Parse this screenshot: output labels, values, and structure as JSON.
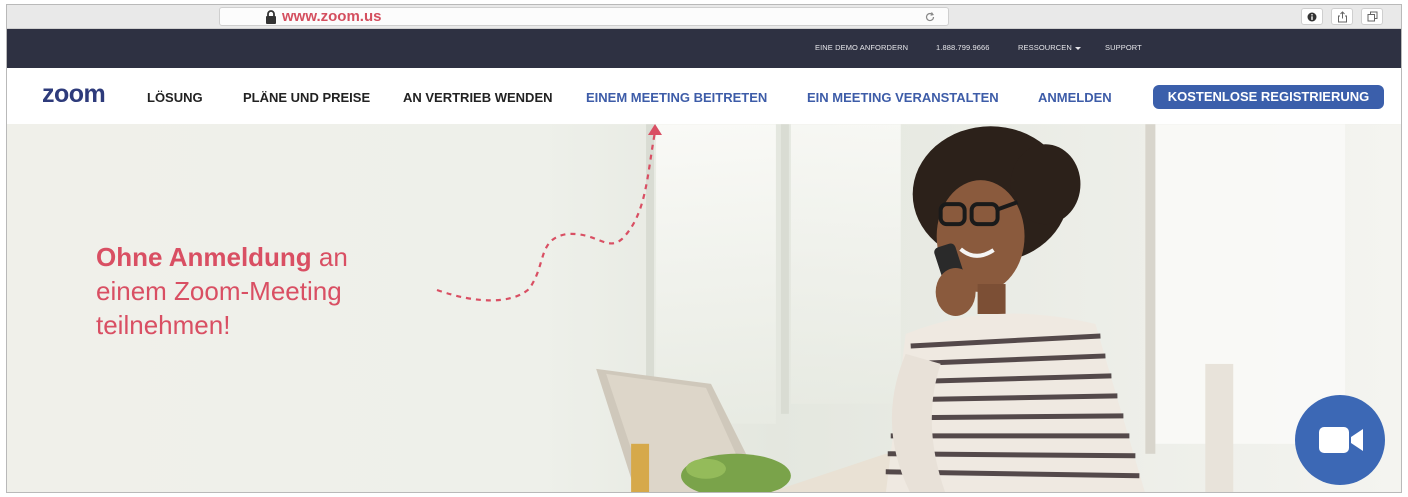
{
  "browser": {
    "url": "www.zoom.us"
  },
  "utility_nav": {
    "demo": "EINE DEMO ANFORDERN",
    "phone": "1.888.799.9666",
    "resources": "RESSOURCEN",
    "support": "SUPPORT"
  },
  "main_nav": {
    "logo": "zoom",
    "items": [
      {
        "label": "LÖSUNG"
      },
      {
        "label": "PLÄNE UND PREISE"
      },
      {
        "label": "AN VERTRIEB WENDEN"
      },
      {
        "label": "EINEM MEETING BEITRETEN"
      },
      {
        "label": "EIN MEETING VERANSTALTEN"
      },
      {
        "label": "ANMELDEN"
      }
    ],
    "signup": "KOSTENLOSE REGISTRIERUNG"
  },
  "hero": {
    "headline_bold": "Ohne Anmeldung",
    "headline_rest_line1": " an",
    "headline_line2": "einem Zoom-Meeting",
    "headline_line3": "teilnehmen!"
  },
  "colors": {
    "accent_pink": "#d94f63",
    "brand_blue": "#3b5fab",
    "util_bar": "#2e3142"
  },
  "icons": [
    "lock-icon",
    "reload-icon",
    "info-icon",
    "share-icon",
    "tabs-icon",
    "video-camera-icon"
  ]
}
